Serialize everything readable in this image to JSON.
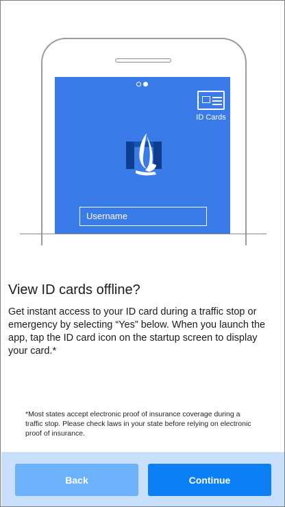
{
  "illustration": {
    "id_cards_label": "ID Cards",
    "username_placeholder": "Username",
    "page_dots": 2,
    "active_dot": 2
  },
  "content": {
    "title": "View ID cards offline?",
    "body": "Get instant access to your ID card during a traffic stop or emergency by selecting “Yes” below. When you launch the app, tap the ID card icon on the startup screen to display your card.*",
    "footnote": "*Most states accept electronic proof of insurance coverage during a traffic stop. Please check laws in your state before relying on electronic proof of insurance."
  },
  "footer": {
    "back_label": "Back",
    "continue_label": "Continue"
  },
  "colors": {
    "screen_blue": "#3a7bea",
    "footer_bg": "#c8e0fb",
    "back_button": "#6cb2fb",
    "continue_button": "#0d7ff5"
  },
  "icons": [
    "id-card-icon",
    "eagle-logo-icon"
  ]
}
